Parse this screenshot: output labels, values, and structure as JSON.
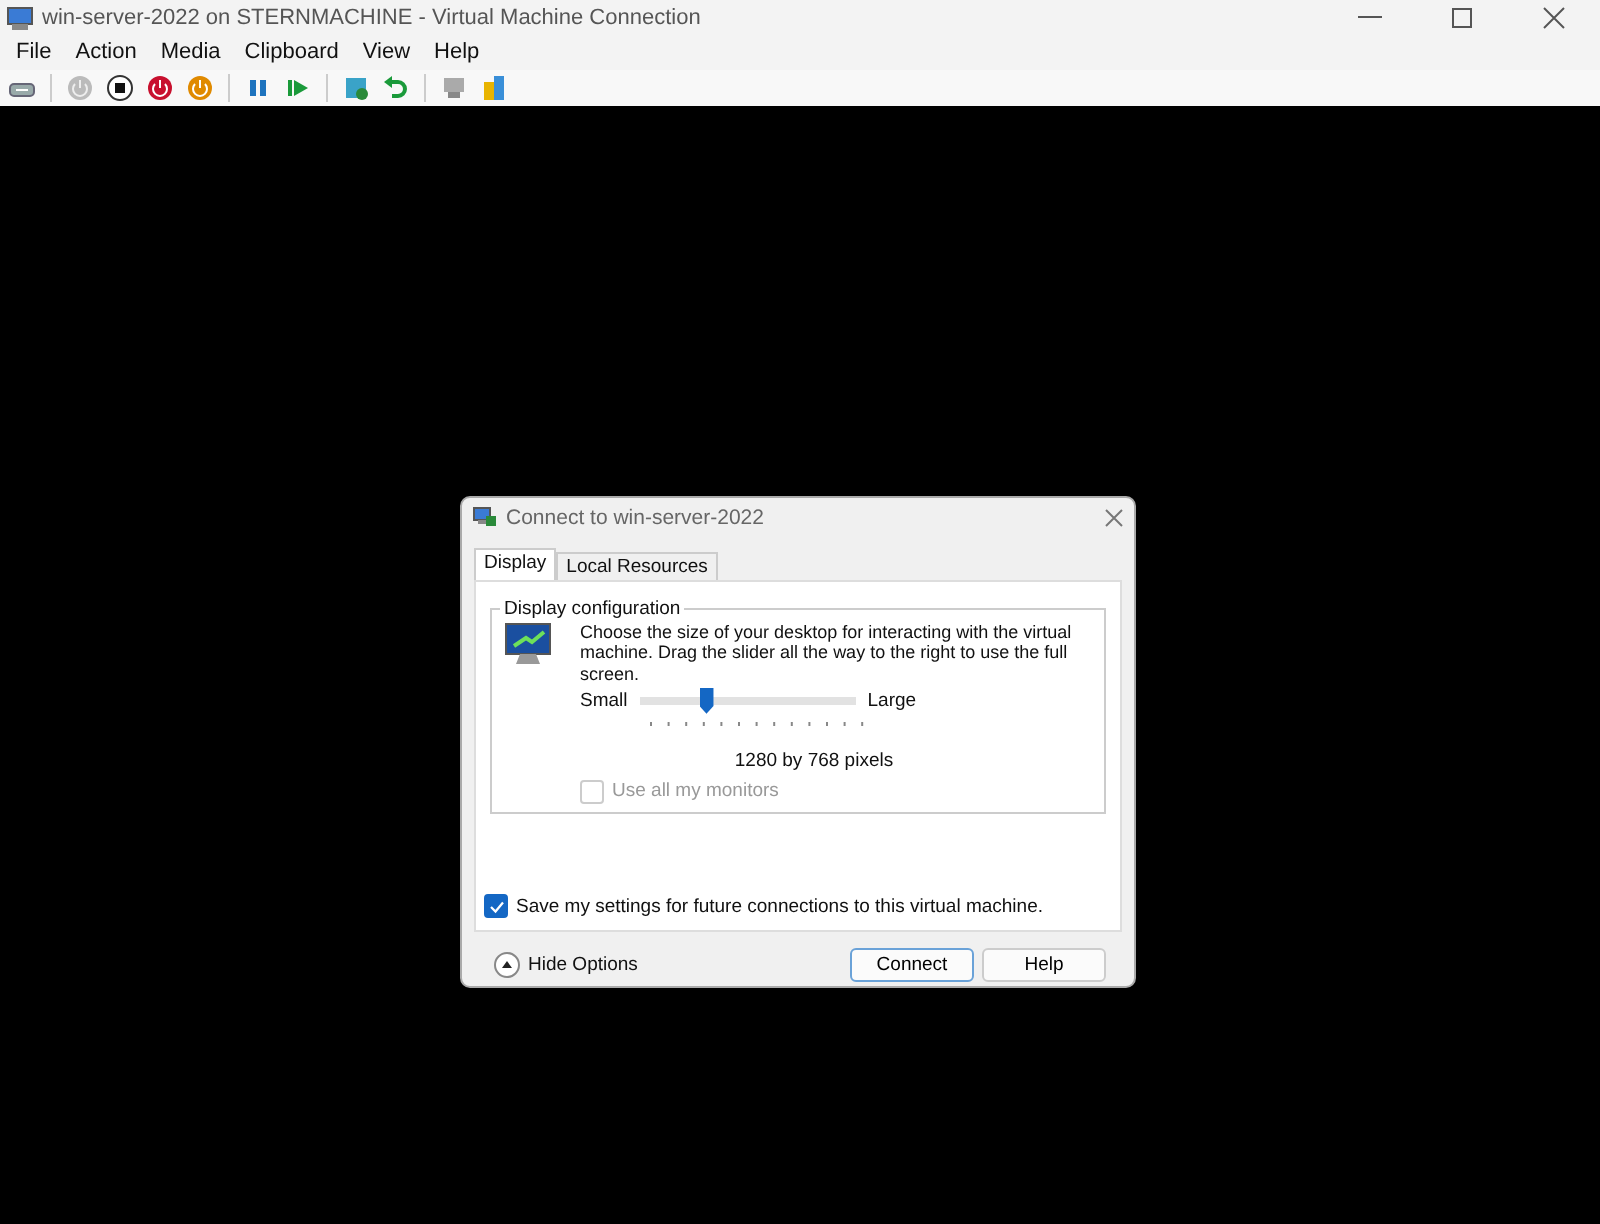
{
  "window": {
    "title": "win-server-2022 on STERNMACHINE - Virtual Machine Connection"
  },
  "menu": [
    "File",
    "Action",
    "Media",
    "Clipboard",
    "View",
    "Help"
  ],
  "dialog": {
    "title": "Connect to win-server-2022",
    "tabs": [
      {
        "label": "Display",
        "selected": true
      },
      {
        "label": "Local Resources",
        "selected": false
      }
    ],
    "group_title": "Display configuration",
    "description": "Choose the size of your desktop for interacting with the virtual machine. Drag the slider all the way to the right to use the full screen.",
    "slider": {
      "min_label": "Small",
      "max_label": "Large",
      "level": 0.31
    },
    "resolution": "1280 by 768 pixels",
    "use_all_monitors": {
      "label": "Use all my monitors",
      "checked": false,
      "disabled": true
    },
    "save_settings": {
      "label": "Save my settings for future connections to this virtual machine.",
      "checked": true
    },
    "hide_options": "Hide Options",
    "buttons": [
      "Connect",
      "Help"
    ]
  }
}
